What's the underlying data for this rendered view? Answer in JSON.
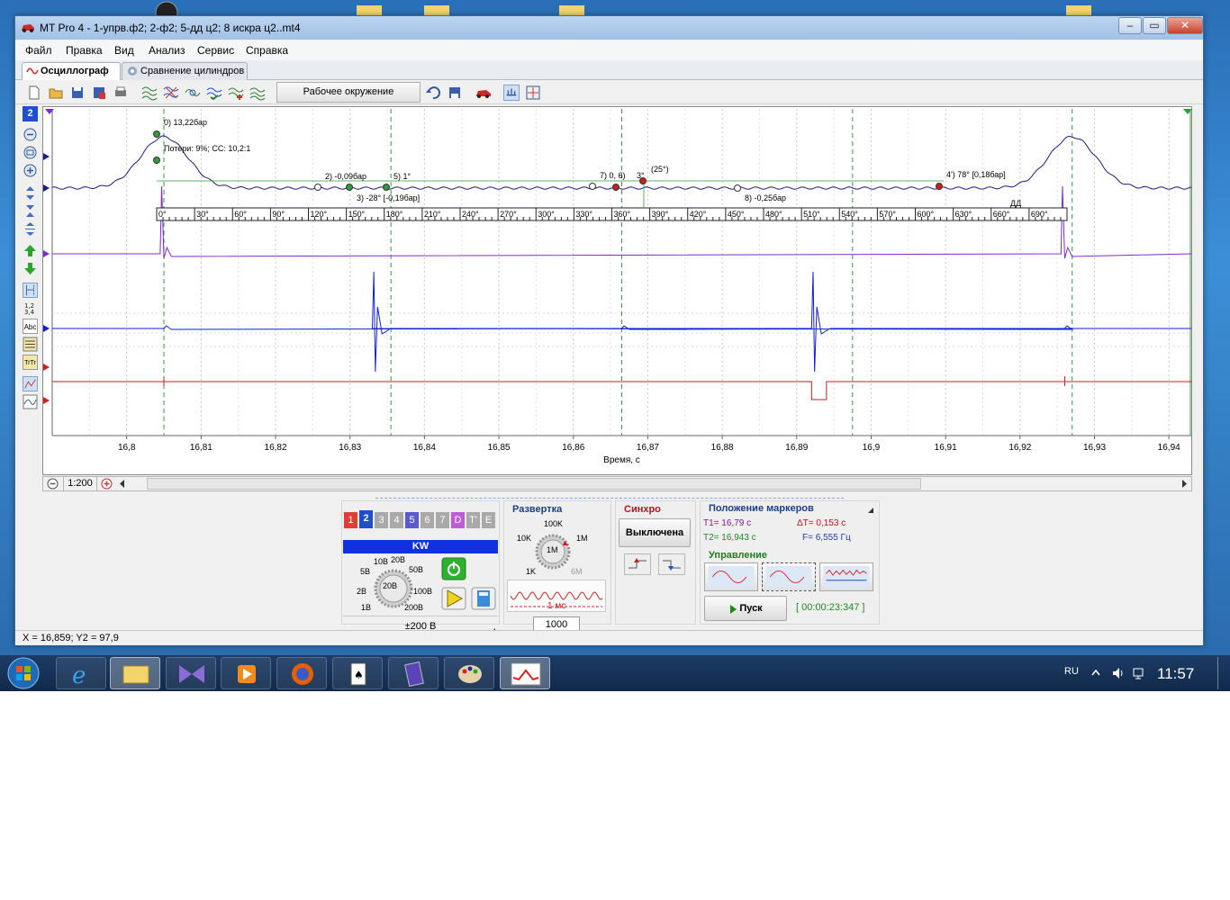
{
  "window": {
    "title": "MT Pro 4 - 1-упрв.ф2; 2-ф2; 5-дд ц2; 8 искра ц2..mt4",
    "minimize": "–",
    "maximize": "▭",
    "close": "✕"
  },
  "menu": [
    "Файл",
    "Правка",
    "Вид",
    "Анализ",
    "Сервис",
    "Справка"
  ],
  "tabs": [
    {
      "label": "Осциллограф",
      "icon": "oscilloscope-icon",
      "active": true
    },
    {
      "label": "Сравнение цилиндров",
      "icon": "compare-cylinders-icon",
      "active": false
    }
  ],
  "toolbar": {
    "environment_button": "Рабочее окружение"
  },
  "left_tools": {
    "channel_number": "2",
    "text_tool": "Abc",
    "font_tool": "TrTr"
  },
  "chart_data": {
    "type": "line",
    "xlabel": "Время, с",
    "x_ticks": [
      "16,8",
      "16,81",
      "16,82",
      "16,83",
      "16,84",
      "16,85",
      "16,86",
      "16,87",
      "16,88",
      "16,89",
      "16,9",
      "16,91",
      "16,92",
      "16,93",
      "16,94"
    ],
    "xlim": [
      16.79,
      16.943
    ],
    "series": [
      {
        "channel": 2,
        "color": "#1a1a8c",
        "peaks_at": [
          16.805,
          16.927
        ]
      },
      {
        "channel": 1,
        "color": "#7c2bd6",
        "pulses_at": [
          16.805,
          16.926
        ]
      },
      {
        "channel": 5,
        "color": "#0d1fd8",
        "spikes_at": [
          16.833,
          16.892
        ]
      },
      {
        "channel": 8,
        "color": "#d21b1b",
        "pulse_at": [
          16.892,
          16.894
        ]
      }
    ],
    "markers": [
      {
        "label": "0)",
        "text": "13,22бар"
      },
      {
        "label": "",
        "text": "Потери: 9%; СС: 10,2:1"
      },
      {
        "label": "2)",
        "text": "-0,09бар"
      },
      {
        "label": "5)",
        "text": "1°"
      },
      {
        "label": "3)",
        "text": "-28° [-0,19бар]"
      },
      {
        "label": "7)",
        "text": "0, 6)"
      },
      {
        "label": "",
        "text": "3°"
      },
      {
        "label": "",
        "text": "(25°)"
      },
      {
        "label": "8)",
        "text": "-0,25бар"
      },
      {
        "label": "4')",
        "text": "78° [0,18бар]"
      }
    ],
    "angle_ruler": [
      "0°",
      "30°",
      "60°",
      "90°",
      "120°",
      "150°",
      "180°",
      "210°",
      "240°",
      "270°",
      "300°",
      "330°",
      "360°",
      "390°",
      "420°",
      "450°",
      "480°",
      "510°",
      "540°",
      "570°",
      "600°",
      "630°",
      "660°",
      "690°"
    ],
    "ruler_tag": "ДД"
  },
  "hscroll": {
    "zoom": "1:200"
  },
  "channels_panel": {
    "tabs": [
      "1",
      "2",
      "3",
      "4",
      "5",
      "6",
      "7",
      "D",
      "T'",
      "E"
    ],
    "tab_colors": [
      "#e03c3c",
      "#1f4fd1",
      "#a9a9a9",
      "#a9a9a9",
      "#5a5ad0",
      "#a9a9a9",
      "#a9a9a9",
      "#c05ad8",
      "#a9a9a9",
      "#a9a9a9"
    ],
    "channel_name": "KW",
    "knob_value": "20В",
    "knob_scales": [
      "10В",
      "20В",
      "5В",
      "50В",
      "2В",
      "100В",
      "1В",
      "200В"
    ],
    "range": "±200 В"
  },
  "sweep_panel": {
    "title": "Развертка",
    "knob_value": "1M",
    "scales": [
      "100K",
      "10K",
      "1M",
      "1K",
      "6M"
    ],
    "time_label": "1 мс",
    "points": "1000"
  },
  "sync_panel": {
    "title": "Синхро",
    "state": "Выключена"
  },
  "markers_panel": {
    "title": "Положение маркеров",
    "t1": "T1= 16,79 с",
    "dt": "ΔT= 0,153 с",
    "t2": "T2= 16,943 с",
    "f": "F= 6,555 Гц"
  },
  "control_panel": {
    "title": "Управление",
    "run": "Пуск",
    "timer": "[ 00:00:23:347 ]"
  },
  "status": "X = 16,859; Y2 = 97,9",
  "taskbar": {
    "lang": "RU",
    "clock": "11:57"
  }
}
